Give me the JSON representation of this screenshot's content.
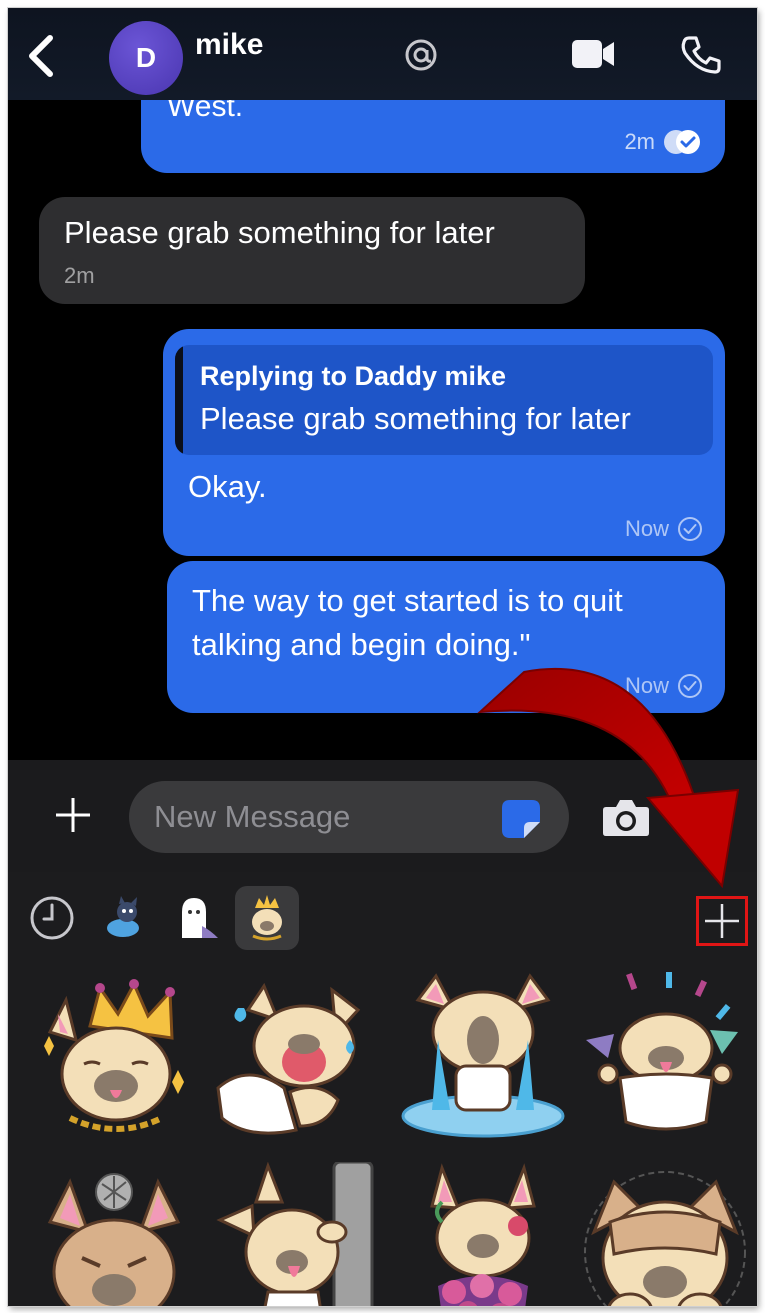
{
  "header": {
    "contact_initial": "D",
    "contact_name": "mike"
  },
  "messages": [
    {
      "direction": "outgoing",
      "text": "West.",
      "time": "2m",
      "status": "read"
    },
    {
      "direction": "incoming",
      "text": "Please grab something for later",
      "time": "2m"
    },
    {
      "direction": "outgoing",
      "reply_title": "Replying to Daddy mike",
      "reply_text": "Please grab something for later",
      "text": "Okay.",
      "time": "Now",
      "status": "sent"
    },
    {
      "direction": "outgoing",
      "text": "The way to get started is to quit talking and begin doing.\"",
      "time": "Now",
      "status": "sent"
    }
  ],
  "composer": {
    "placeholder": "New Message"
  },
  "sticker_tray": {
    "tabs": [
      "recent-icon",
      "sticker-pack-tab",
      "sticker-pack-tab",
      "sticker-pack-tab"
    ],
    "active_tab_index": 3,
    "stickers": [
      "crowned-dog-sticker",
      "crying-dog-sticker",
      "sobbing-puddle-dog-sticker",
      "party-dog-sticker",
      "angry-dog-sticker",
      "peeking-dog-sticker",
      "flower-dog-sticker",
      "covering-eyes-dog-sticker"
    ]
  },
  "colors": {
    "outgoing_bubble": "#2b6ae8",
    "incoming_bubble": "#2e2e30",
    "reply_box": "#1e55c8",
    "highlight": "#e01515",
    "annotation_arrow": "#b50000"
  }
}
